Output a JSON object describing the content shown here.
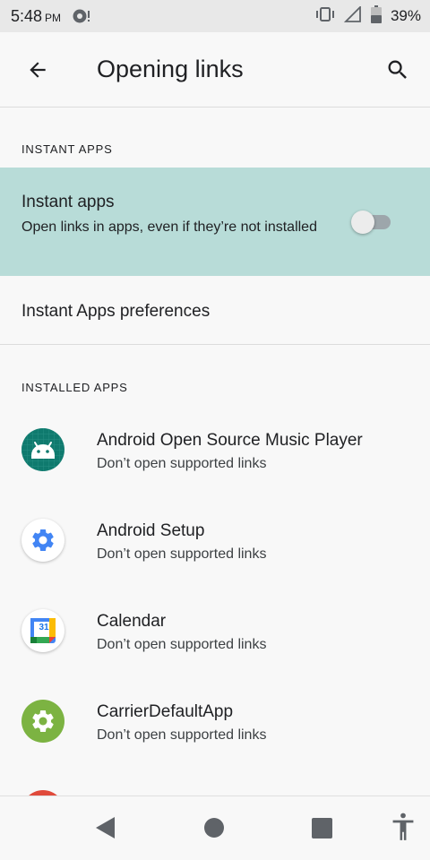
{
  "status_bar": {
    "time": "5:48",
    "ampm": "PM",
    "battery_text": "39%",
    "icons": [
      "notification-icon",
      "vibrate-icon",
      "signal-icon",
      "battery-icon"
    ]
  },
  "app_bar": {
    "title": "Opening links",
    "icons": [
      "back-arrow-icon",
      "search-icon"
    ]
  },
  "instant_apps_section": {
    "header": "INSTANT APPS",
    "toggle": {
      "title": "Instant apps",
      "summary": "Open links in apps, even if they’re not installed",
      "enabled": false
    },
    "preferences_label": "Instant Apps preferences"
  },
  "installed_apps_section": {
    "header": "INSTALLED APPS",
    "apps": [
      {
        "name": "Android Open Source Music Player",
        "status": "Don’t open supported links",
        "icon": "android-icon",
        "color": "#0f7a6e"
      },
      {
        "name": "Android Setup",
        "status": "Don’t open supported links",
        "icon": "gear-icon",
        "color": "#4285f4"
      },
      {
        "name": "Calendar",
        "status": "Don’t open supported links",
        "icon": "calendar-icon",
        "day": "31"
      },
      {
        "name": "CarrierDefaultApp",
        "status": "Don’t open supported links",
        "icon": "gear-icon",
        "color": "#7cb342"
      }
    ]
  },
  "nav_bar": {
    "icons": [
      "nav-back-icon",
      "nav-home-icon",
      "nav-recents-icon",
      "accessibility-icon"
    ]
  },
  "colors": {
    "highlight": "#b8dcd8",
    "music_icon": "#0f7a6e",
    "setup_icon": "#4285f4",
    "carrier_icon": "#7cb342"
  }
}
